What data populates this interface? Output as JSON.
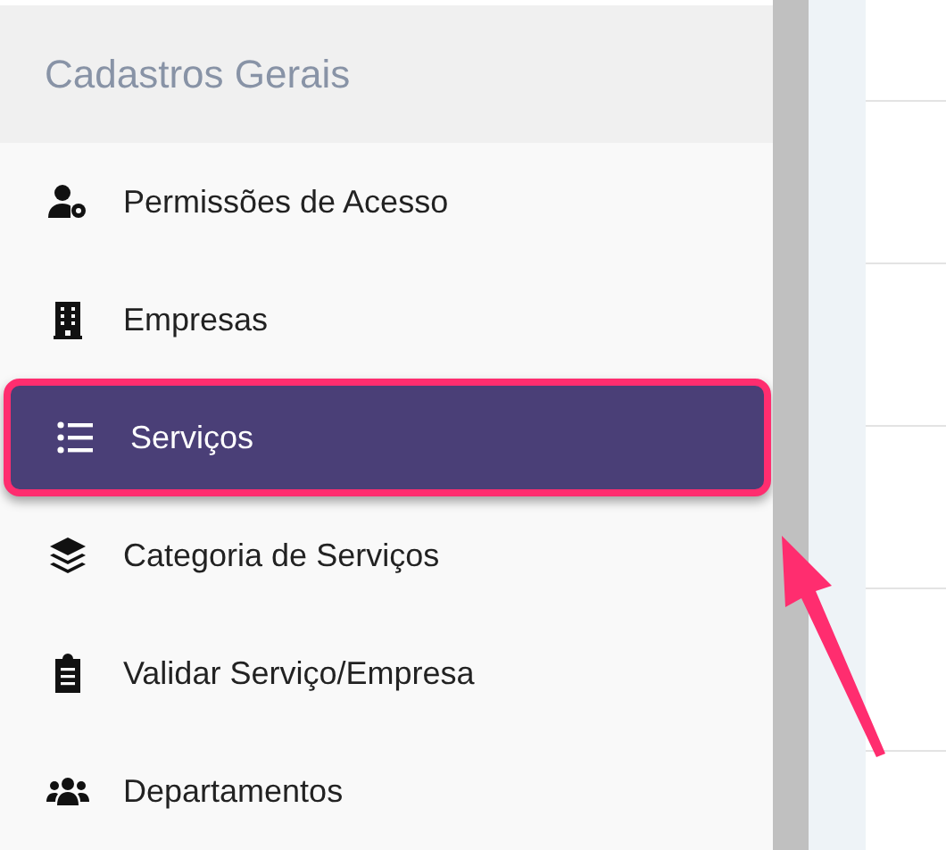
{
  "sidebar": {
    "section_title": "Cadastros Gerais",
    "items": [
      {
        "label": "Permissões de Acesso",
        "selected": false,
        "highlighted": false
      },
      {
        "label": "Empresas",
        "selected": false,
        "highlighted": false
      },
      {
        "label": "Serviços",
        "selected": true,
        "highlighted": true
      },
      {
        "label": "Categoria de Serviços",
        "selected": false,
        "highlighted": false
      },
      {
        "label": "Validar Serviço/Empresa",
        "selected": false,
        "highlighted": false
      },
      {
        "label": "Departamentos",
        "selected": false,
        "highlighted": false
      }
    ]
  }
}
